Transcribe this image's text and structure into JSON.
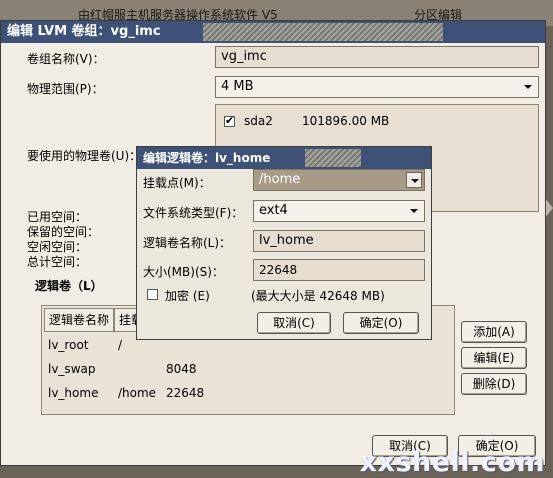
{
  "backdrop": {
    "title_left": "由红帽服主机服务器操作系统软件 V5",
    "title_right": "分区编辑",
    "watermark": "xxshell.com"
  },
  "lvm_dialog": {
    "title": "编辑 LVM 卷组：vg_imc",
    "vg_name_label": "卷组名称(V)：",
    "vg_name_value": "vg_imc",
    "pe_label": "物理范围(P)：",
    "pe_value": "4 MB",
    "pv_label": "要使用的物理卷(U)：",
    "pv_items": [
      {
        "name": "sda2",
        "size": "101896.00 MB",
        "checked": true
      }
    ],
    "used_space_label": "已用空间：",
    "reserved_space_label": "保留的空间：",
    "free_space_label": "空闲空间：",
    "total_space_label": "总计空间：",
    "lv_section_label": "逻辑卷（L）",
    "lv_columns": [
      "逻辑卷名称",
      "挂载"
    ],
    "lv_rows": [
      {
        "name": "lv_root",
        "mount": "/",
        "size": ""
      },
      {
        "name": "lv_swap",
        "mount": "",
        "size": "8048"
      },
      {
        "name": "lv_home",
        "mount": "/home",
        "size": "22648"
      }
    ],
    "add_button": "添加(A)",
    "edit_button": "编辑(E)",
    "delete_button": "删除(D)",
    "cancel_button": "取消(C)",
    "ok_button": "确定(O)"
  },
  "lv_dialog": {
    "title": "编辑逻辑卷：lv_home",
    "mount_label": "挂载点(M)：",
    "mount_value": "/home",
    "fs_label": "文件系统类型(F)：",
    "fs_value": "ext4",
    "lv_name_label": "逻辑卷名称(L)：",
    "lv_name_value": "lv_home",
    "size_label": "大小(MB)(S)：",
    "size_value": "22648",
    "encrypt_label": "加密 (E)",
    "encrypt_checked": false,
    "max_size_text": "(最大大小是 42648 MB)",
    "cancel_button": "取消(C)",
    "ok_button": "确定(O)"
  }
}
